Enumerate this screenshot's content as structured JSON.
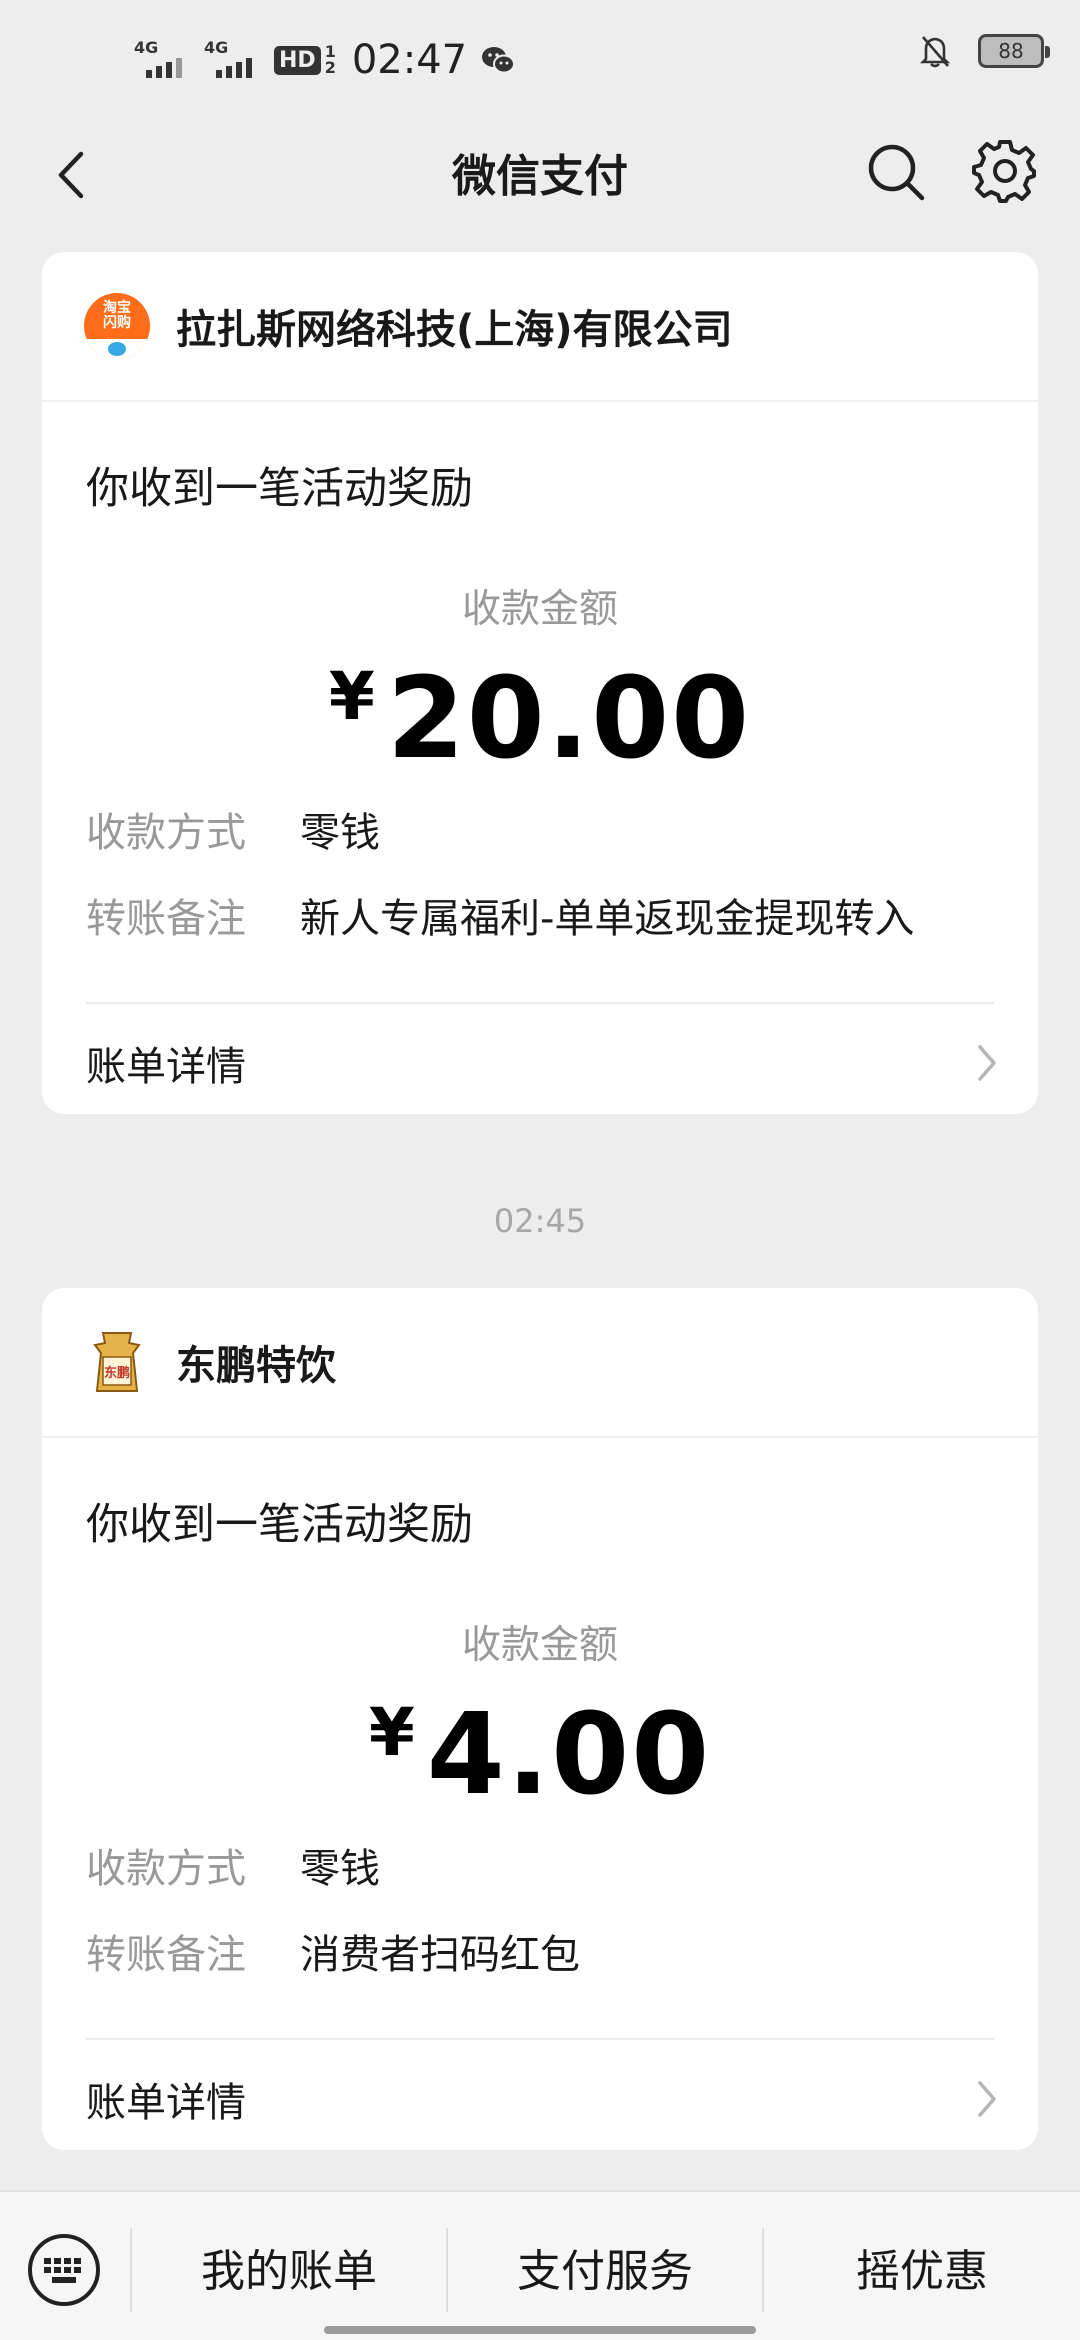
{
  "status_bar": {
    "signal1_label": "4G",
    "signal2_label": "4G",
    "hd_label": "HD",
    "hd_sub_top": "1",
    "hd_sub_bottom": "2",
    "time": "02:47",
    "battery": "88"
  },
  "nav": {
    "title": "微信支付",
    "back_icon": "chevron-left-icon",
    "search_icon": "search-icon",
    "settings_icon": "gear-icon"
  },
  "cards": [
    {
      "merchant_name": "拉扎斯网络科技(上海)有限公司",
      "logo_text_line1": "淘宝",
      "logo_text_line2": "闪购",
      "title": "你收到一笔活动奖励",
      "amount_label": "收款金额",
      "currency": "¥",
      "amount": "20.00",
      "method_label": "收款方式",
      "method_value": "零钱",
      "note_label": "转账备注",
      "note_value": "新人专属福利-单单返现金提现转入",
      "detail_label": "账单详情"
    },
    {
      "merchant_name": "东鹏特饮",
      "logo_text": "东鹏",
      "title": "你收到一笔活动奖励",
      "amount_label": "收款金额",
      "currency": "¥",
      "amount": "4.00",
      "method_label": "收款方式",
      "method_value": "零钱",
      "note_label": "转账备注",
      "note_value": "消费者扫码红包",
      "detail_label": "账单详情"
    }
  ],
  "timestamp": "02:45",
  "bottom_bar": {
    "keyboard_icon": "keyboard-icon",
    "tabs": [
      "我的账单",
      "支付服务",
      "摇优惠"
    ]
  },
  "colors": {
    "background": "#ededed",
    "card": "#ffffff",
    "muted_text": "#999999"
  }
}
